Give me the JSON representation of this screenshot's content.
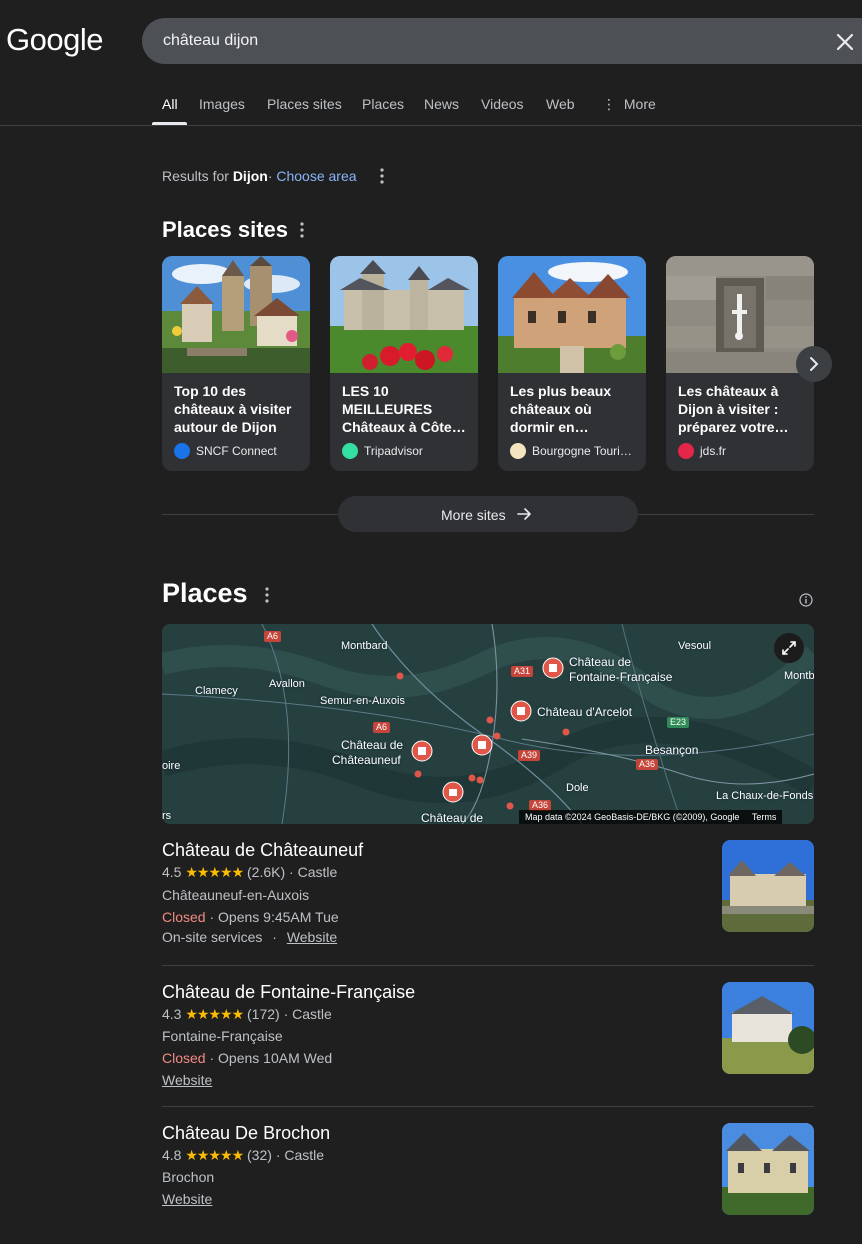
{
  "brand": {
    "logo": "Google"
  },
  "search": {
    "query": "château dijon"
  },
  "tabs": [
    "All",
    "Images",
    "Places sites",
    "Places",
    "News",
    "Videos",
    "Web",
    "More"
  ],
  "results_for": {
    "prefix": "Results for",
    "location": "Dijon",
    "separator": "·",
    "choose_area": "Choose area"
  },
  "places_sites": {
    "title": "Places sites",
    "cards": [
      {
        "title": "Top 10 des châteaux à visiter autour de Dijon",
        "source": "SNCF Connect"
      },
      {
        "title": "LES 10 MEILLEURES Châteaux à Côte…",
        "source": "Tripadvisor"
      },
      {
        "title": "Les plus beaux châteaux où dormir en…",
        "source": "Bourgogne Touri…"
      },
      {
        "title": "Les châteaux à Dijon à visiter : préparez votre…",
        "source": "jds.fr"
      }
    ],
    "more_label": "More sites"
  },
  "places": {
    "title": "Places",
    "map": {
      "labels": [
        "Montbard",
        "Vesoul",
        "Montb",
        "Clamecy",
        "Avallon",
        "Semur-en-Auxois",
        "Château de",
        "Fontaine-Française",
        "Château d'Arcelot",
        "Château de",
        "Châteauneuf",
        "Besançon",
        "Dole",
        "La Chaux-de-Fonds",
        "Château de",
        "oire",
        "rs"
      ],
      "roads": [
        "A6",
        "A31",
        "A6",
        "E23",
        "A39",
        "A36",
        "A36"
      ],
      "attribution": "Map data ©2024 GeoBasis-DE/BKG (©2009), Google",
      "terms": "Terms"
    },
    "list": [
      {
        "name": "Château de Châteauneuf",
        "rating": "4.5",
        "stars": "★★★★★",
        "reviews": "(2.6K)",
        "category": "· Castle",
        "location": "Châteauneuf-en-Auxois",
        "status": "Closed",
        "hours": "· Opens 9:45AM Tue",
        "services": "On-site services",
        "services_sep": "·",
        "website": "Website"
      },
      {
        "name": "Château de Fontaine-Française",
        "rating": "4.3",
        "stars": "★★★★★",
        "reviews": "(172)",
        "category": "· Castle",
        "location": "Fontaine-Française",
        "status": "Closed",
        "hours": "· Opens 10AM Wed",
        "website": "Website"
      },
      {
        "name": "Château De Brochon",
        "rating": "4.8",
        "stars": "★★★★★",
        "reviews": "(32)",
        "category": "· Castle",
        "location": "Brochon",
        "website": "Website"
      }
    ]
  }
}
